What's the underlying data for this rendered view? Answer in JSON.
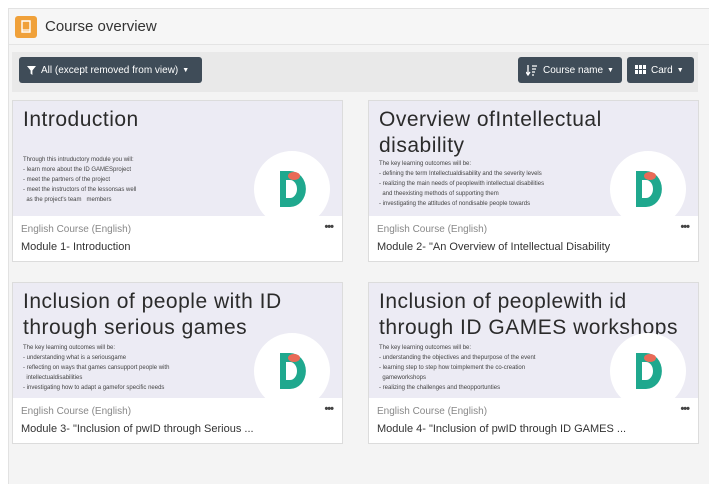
{
  "header": {
    "title": "Course overview",
    "icon": "book-icon",
    "accent": "#f0a13a"
  },
  "toolbar": {
    "filter_label": "All (except removed from view)",
    "sort_label": "Course name",
    "view_label": "Card",
    "button_color": "#3f4c58"
  },
  "courses": [
    {
      "heading": "Introduction",
      "lines": [
        "Through this intruductory module you will:",
        "- learn more about the ID GAMESproject",
        "- meet the partners of the project",
        "- meet the instructors of the lessonsas well",
        "  as the project's team   members"
      ],
      "category": "English Course (English)",
      "title": "Module 1- Introduction"
    },
    {
      "heading": "Overview ofIntellectual disability",
      "lines": [
        "The key learning outcomes will be:",
        "- defining the term Intellectualdisability and the severity levels",
        "- realizing the main needs of peoplewith intellectual disabilities",
        "  and theexisting methods of supporting them",
        "- investigating the attitudes of nondisable people towards"
      ],
      "category": "English Course (English)",
      "title": "Module 2- \"An Overview of Intellectual Disability"
    },
    {
      "heading": "Inclusion of people with ID through serious games",
      "lines": [
        "The key learning outcomes will be:",
        "- understanding what is a seriousgame",
        "- reflecting on ways that games cansupport people with",
        "  intellectualdisabilities",
        "- investigating how to adapt a gamefor specific needs"
      ],
      "category": "English Course (English)",
      "title": "Module 3- \"Inclusion of pwID through Serious ..."
    },
    {
      "heading": "Inclusion of peoplewith id through ID GAMES workshops",
      "lines": [
        "The key learning outcomes will be:",
        "- understanding the objectives and thepurpose of the event",
        "- learning step to step how toimplement the co-creation",
        "  gameworkshops",
        "- realizing the challenges and theopportunties"
      ],
      "category": "English Course (English)",
      "title": "Module 4- \"Inclusion of pwID through ID GAMES ..."
    }
  ],
  "more_label": "•••",
  "logo_colors": {
    "teal": "#1fa88e",
    "coral": "#e96a57"
  }
}
